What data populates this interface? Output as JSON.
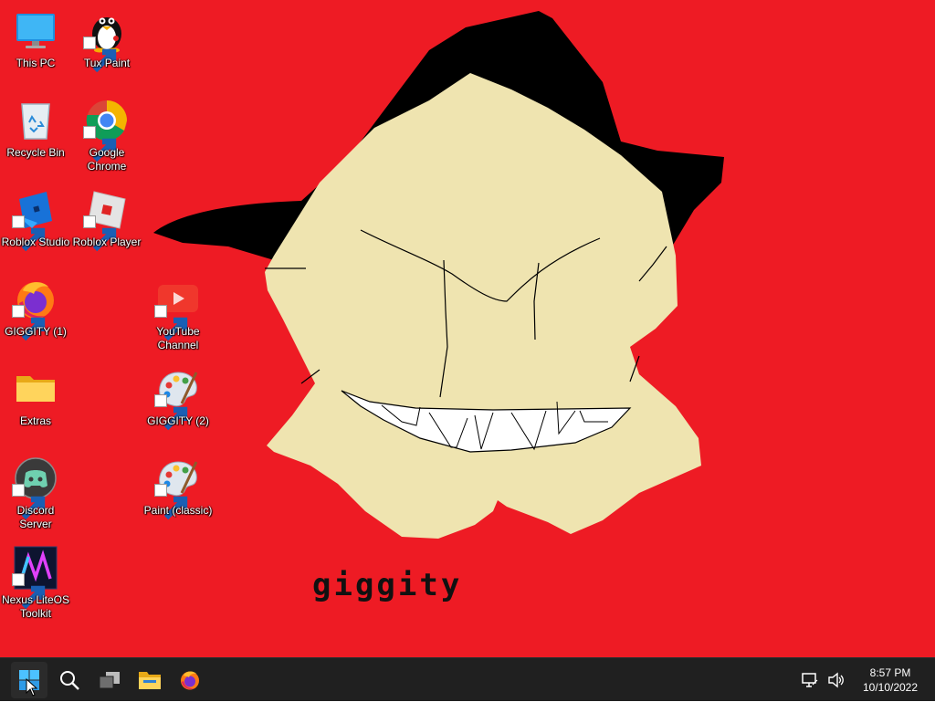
{
  "desktop": {
    "wallpaper_text": "giggity",
    "icons": [
      {
        "name": "this-pc",
        "label": "This PC"
      },
      {
        "name": "tux-paint",
        "label": "Tux Paint"
      },
      {
        "name": "recycle-bin",
        "label": "Recycle Bin"
      },
      {
        "name": "google-chrome",
        "label": "Google Chrome"
      },
      {
        "name": "roblox-studio",
        "label": "Roblox Studio"
      },
      {
        "name": "roblox-player",
        "label": "Roblox Player"
      },
      {
        "name": "giggity-1",
        "label": "GIGGITY (1)"
      },
      {
        "name": "youtube-channel",
        "label": "YouTube Channel"
      },
      {
        "name": "extras",
        "label": "Extras"
      },
      {
        "name": "giggity-2",
        "label": "GIGGITY (2)"
      },
      {
        "name": "discord-server",
        "label": "Discord Server"
      },
      {
        "name": "paint-classic",
        "label": "Paint (classic)"
      },
      {
        "name": "nexus-liteos-toolkit",
        "label": "Nexus LiteOS Toolkit"
      }
    ]
  },
  "taskbar": {
    "buttons": [
      "start-icon",
      "search-icon",
      "task-view-icon",
      "file-explorer-icon",
      "firefox-icon"
    ],
    "tray": {
      "icons": [
        "network-icon",
        "volume-icon"
      ],
      "time": "8:57 PM",
      "date": "10/10/2022"
    }
  },
  "colors": {
    "wallpaper_red": "#ee1b24",
    "face_tan": "#efe4b0",
    "taskbar": "#202020",
    "accent_blue": "#0078d4"
  }
}
